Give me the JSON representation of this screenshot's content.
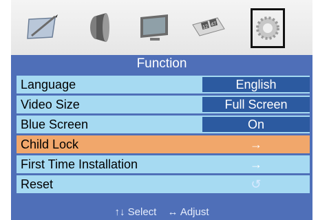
{
  "osd": {
    "icons": [
      {
        "name": "picture-icon"
      },
      {
        "name": "sound-icon"
      },
      {
        "name": "screen-icon"
      },
      {
        "name": "timer-icon"
      },
      {
        "name": "gear-icon"
      }
    ],
    "menu_title": "Function",
    "items": [
      {
        "label": "Language",
        "value": "English",
        "type": "value"
      },
      {
        "label": "Video Size",
        "value": "Full Screen",
        "type": "value"
      },
      {
        "label": "Blue Screen",
        "value": "On",
        "type": "value"
      },
      {
        "label": "Child Lock",
        "value": "→",
        "type": "arrow",
        "selected": true
      },
      {
        "label": "First Time Installation",
        "value": "→",
        "type": "arrow"
      },
      {
        "label": "Reset",
        "value": "↺",
        "type": "arrow"
      }
    ],
    "footer": {
      "select_label": "↑↓ Select",
      "adjust_label": "↔ Adjust"
    },
    "colors": {
      "panel": "#4f6fb8",
      "row": "#a6daf2",
      "selected": "#f1a76b",
      "value_box": "#2c5aa0"
    }
  }
}
